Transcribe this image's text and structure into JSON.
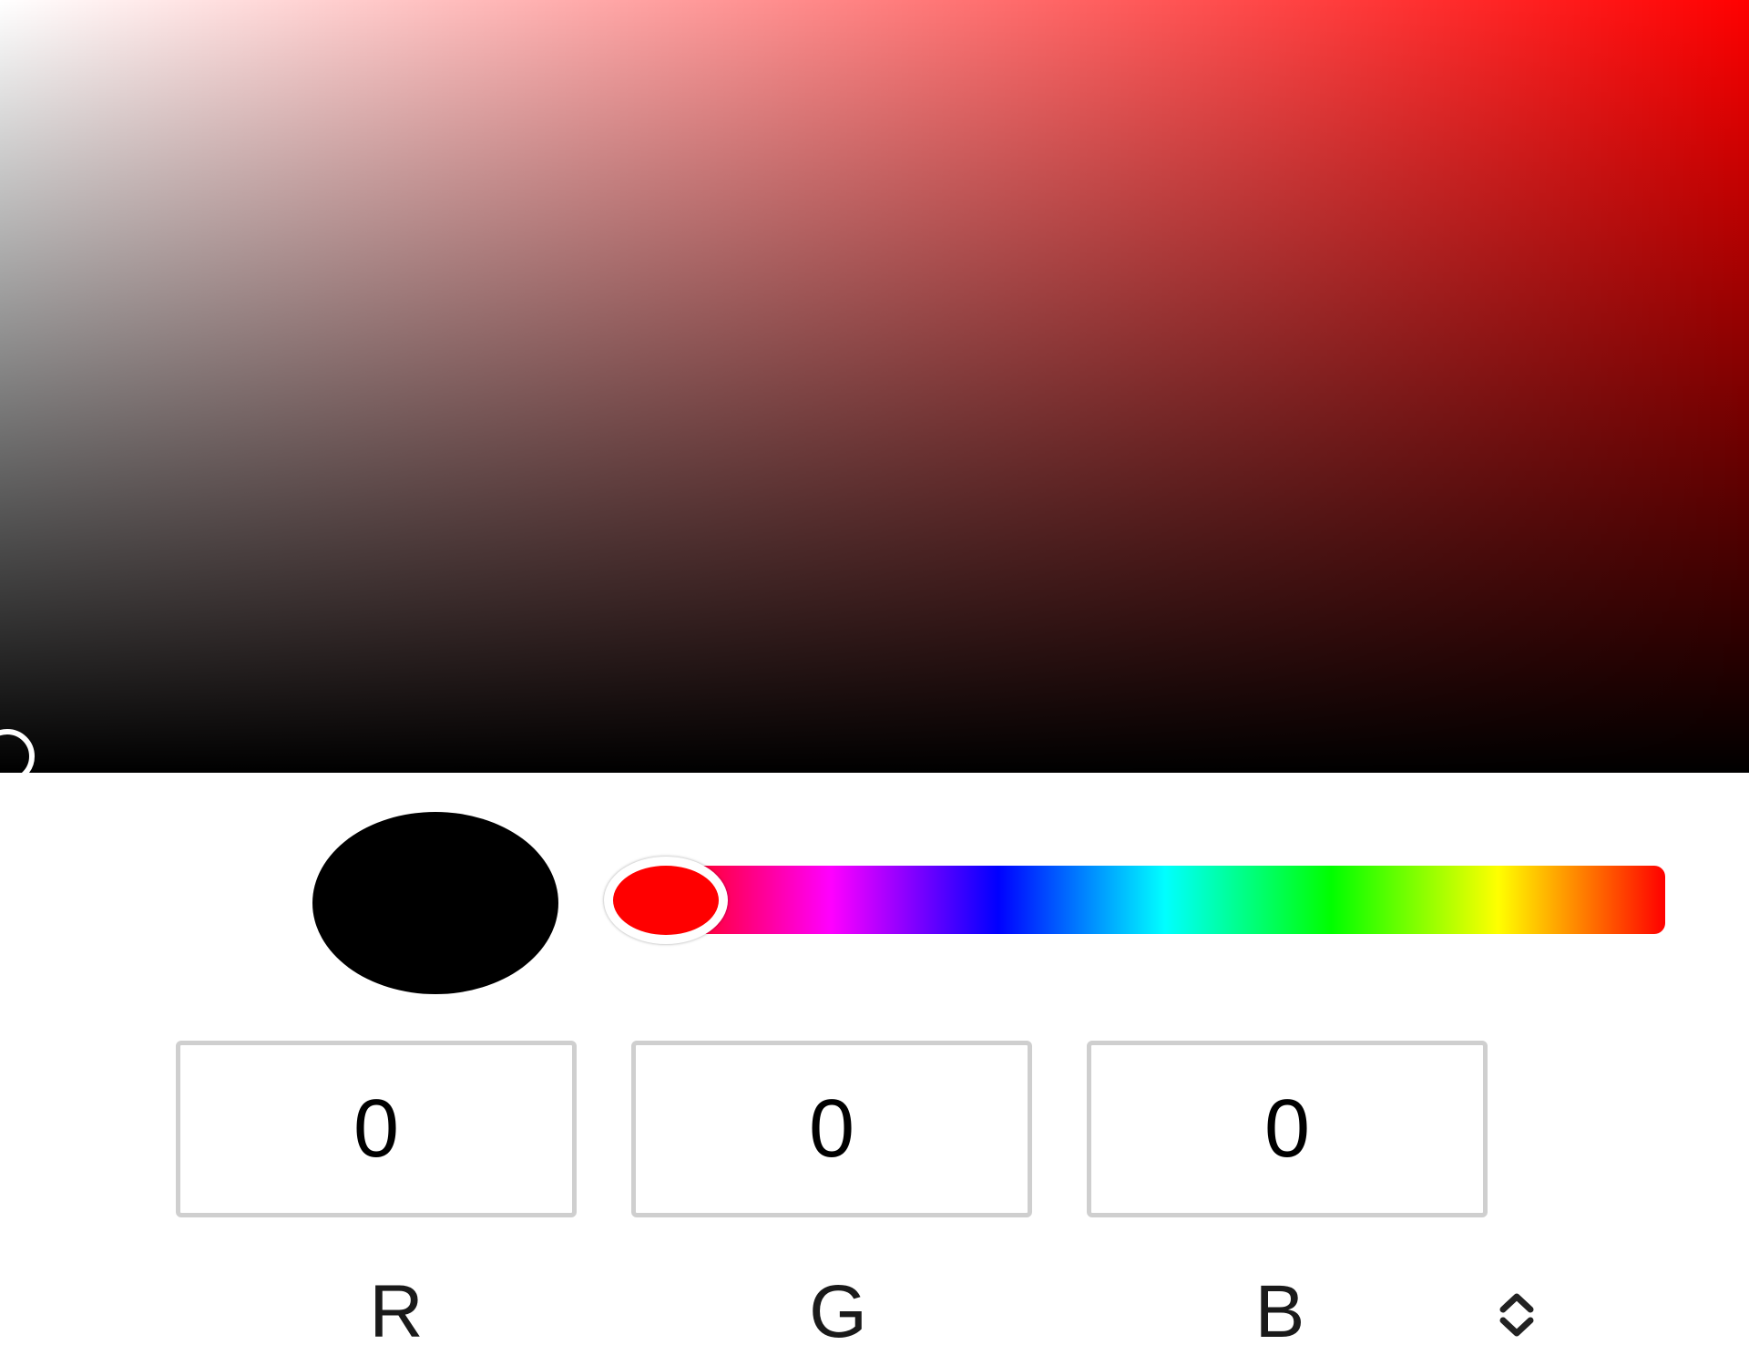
{
  "color_picker": {
    "hue_color": "#ff0000",
    "selected_color": "#000000",
    "hue_degrees": 0,
    "saturation_percent": 0,
    "value_percent": 0
  },
  "channels": {
    "r": {
      "value": "0",
      "label": "R"
    },
    "g": {
      "value": "0",
      "label": "G"
    },
    "b": {
      "value": "0",
      "label": "B"
    }
  },
  "toggle": {
    "icon": "chevron-up-down-icon"
  }
}
